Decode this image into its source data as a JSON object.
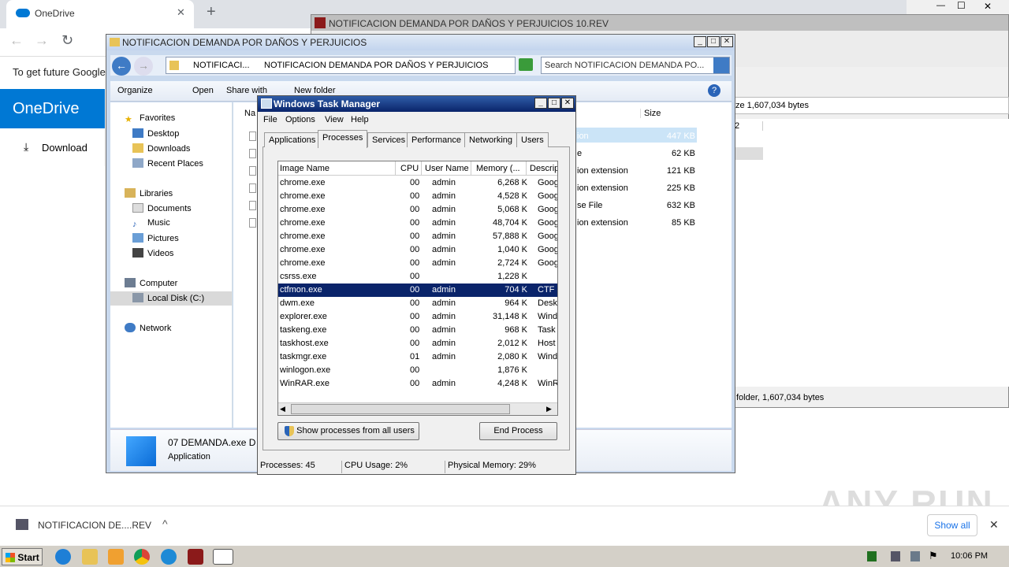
{
  "chrome": {
    "tab_title": "OneDrive",
    "new_tab": "+",
    "close": "✕",
    "banner": "To get future Google",
    "back": "←",
    "forward": "→",
    "reload": "↻",
    "win_min": "—",
    "win_max": "☐",
    "win_close": "✕"
  },
  "onedrive": {
    "brand": "OneDrive",
    "download_label": "Download"
  },
  "shelf": {
    "file": "NOTIFICACION DE....REV",
    "chevron": "^",
    "show_all": "Show all",
    "close": "✕"
  },
  "watermark": "ANY RUN",
  "rar": {
    "title": "NOTIFICACION DEMANDA POR DAÑOS Y PERJUICIOS 10.REV",
    "size_text": "ze 1,607,034 bytes",
    "status_text": "folder, 1,607,034 bytes",
    "col2": "2"
  },
  "explorer": {
    "title": "NOTIFICACION DEMANDA POR DAÑOS Y PERJUICIOS",
    "breadcrumb1": "NOTIFICACI...",
    "breadcrumb2": "NOTIFICACION DEMANDA POR DAÑOS Y PERJUICIOS",
    "search_placeholder": "Search NOTIFICACION DEMANDA PO...",
    "cmd": {
      "organize": "Organize",
      "open": "Open",
      "share": "Share with",
      "newfolder": "New folder"
    },
    "nav": {
      "favorites": "Favorites",
      "desktop": "Desktop",
      "downloads": "Downloads",
      "recent": "Recent Places",
      "libraries": "Libraries",
      "documents": "Documents",
      "music": "Music",
      "pictures": "Pictures",
      "videos": "Videos",
      "computer": "Computer",
      "localdisk": "Local Disk (C:)",
      "network": "Network"
    },
    "col_name": "Na",
    "col_size": "Size",
    "files": [
      {
        "type": "ion",
        "size": "447 KB"
      },
      {
        "type": "e",
        "size": "62 KB"
      },
      {
        "type": "ion extension",
        "size": "121 KB"
      },
      {
        "type": "ion extension",
        "size": "225 KB"
      },
      {
        "type": "se File",
        "size": "632 KB"
      },
      {
        "type": "ion extension",
        "size": "85 KB"
      }
    ],
    "details": {
      "name": "07 DEMANDA.exe  D",
      "type": "Application"
    }
  },
  "taskmgr": {
    "title": "Windows Task Manager",
    "menu": {
      "file": "File",
      "options": "Options",
      "view": "View",
      "help": "Help"
    },
    "tabs": {
      "applications": "Applications",
      "processes": "Processes",
      "services": "Services",
      "performance": "Performance",
      "networking": "Networking",
      "users": "Users"
    },
    "cols": {
      "image": "Image Name",
      "cpu": "CPU",
      "user": "User Name",
      "memory": "Memory (...",
      "desc": "Descrip"
    },
    "processes": [
      {
        "name": "chrome.exe",
        "cpu": "00",
        "user": "admin",
        "mem": "6,268 K",
        "desc": "Goog"
      },
      {
        "name": "chrome.exe",
        "cpu": "00",
        "user": "admin",
        "mem": "4,528 K",
        "desc": "Goog"
      },
      {
        "name": "chrome.exe",
        "cpu": "00",
        "user": "admin",
        "mem": "5,068 K",
        "desc": "Goog"
      },
      {
        "name": "chrome.exe",
        "cpu": "00",
        "user": "admin",
        "mem": "48,704 K",
        "desc": "Goog"
      },
      {
        "name": "chrome.exe",
        "cpu": "00",
        "user": "admin",
        "mem": "57,888 K",
        "desc": "Goog"
      },
      {
        "name": "chrome.exe",
        "cpu": "00",
        "user": "admin",
        "mem": "1,040 K",
        "desc": "Goog"
      },
      {
        "name": "chrome.exe",
        "cpu": "00",
        "user": "admin",
        "mem": "2,724 K",
        "desc": "Goog"
      },
      {
        "name": "csrss.exe",
        "cpu": "00",
        "user": "",
        "mem": "1,228 K",
        "desc": ""
      },
      {
        "name": "ctfmon.exe",
        "cpu": "00",
        "user": "admin",
        "mem": "704 K",
        "desc": "CTF I"
      },
      {
        "name": "dwm.exe",
        "cpu": "00",
        "user": "admin",
        "mem": "964 K",
        "desc": "Desk"
      },
      {
        "name": "explorer.exe",
        "cpu": "00",
        "user": "admin",
        "mem": "31,148 K",
        "desc": "Wind"
      },
      {
        "name": "taskeng.exe",
        "cpu": "00",
        "user": "admin",
        "mem": "968 K",
        "desc": "Task"
      },
      {
        "name": "taskhost.exe",
        "cpu": "00",
        "user": "admin",
        "mem": "2,012 K",
        "desc": "Host"
      },
      {
        "name": "taskmgr.exe",
        "cpu": "01",
        "user": "admin",
        "mem": "2,080 K",
        "desc": "Wind"
      },
      {
        "name": "winlogon.exe",
        "cpu": "00",
        "user": "",
        "mem": "1,876 K",
        "desc": ""
      },
      {
        "name": "WinRAR.exe",
        "cpu": "00",
        "user": "admin",
        "mem": "4,248 K",
        "desc": "WinR"
      }
    ],
    "show_all": "Show processes from all users",
    "end_process": "End Process",
    "status": {
      "processes": "Processes: 45",
      "cpu": "CPU Usage: 2%",
      "memory": "Physical Memory: 29%"
    }
  },
  "taskbar": {
    "start": "Start",
    "clock": "10:06 PM"
  }
}
